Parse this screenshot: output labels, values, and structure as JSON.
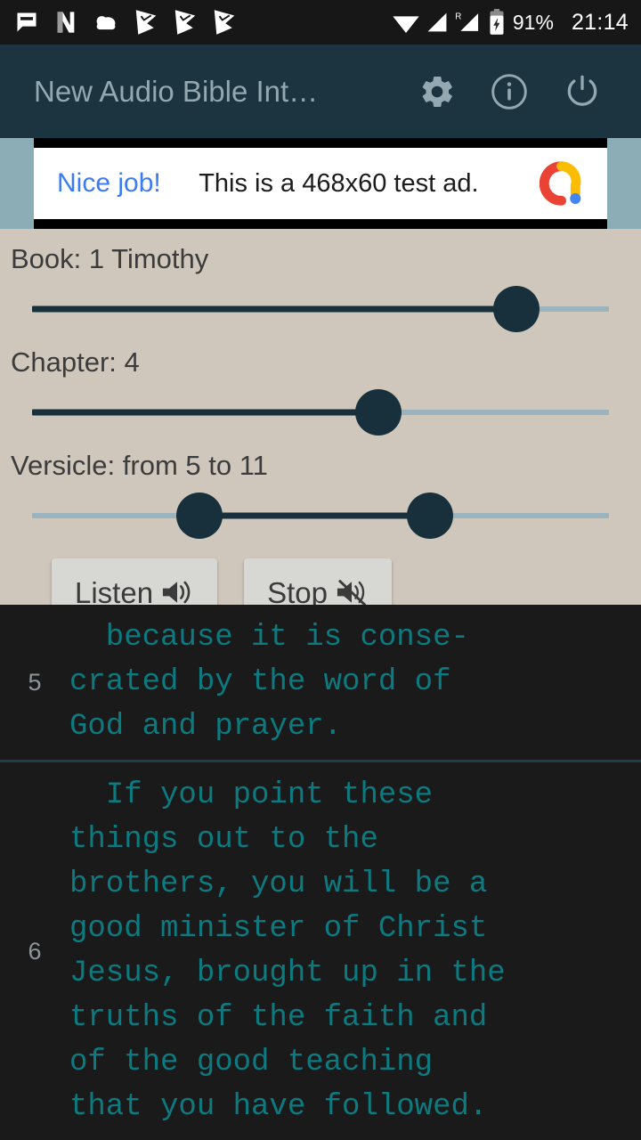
{
  "status_bar": {
    "icons_left": [
      "message-icon",
      "netflix-n-icon",
      "cloud-icon",
      "check-flag-icon",
      "check-flag-icon",
      "check-flag-icon"
    ],
    "icons_right": [
      "wifi-icon",
      "signal-icon",
      "signal-roaming-icon",
      "battery-charging-icon"
    ],
    "roaming_label": "R",
    "battery_percent": "91%",
    "clock": "21:14",
    "background": "#171717",
    "foreground": "#ffffff"
  },
  "app_bar": {
    "title": "New Audio Bible Int…",
    "background": "#1b3440",
    "icon_color": "#93a8b0",
    "actions": [
      {
        "name": "settings-button",
        "icon": "gear-icon"
      },
      {
        "name": "info-button",
        "icon": "info-circle-icon"
      },
      {
        "name": "power-button",
        "icon": "power-icon"
      }
    ]
  },
  "ad": {
    "cta": "Nice job!",
    "text": "This is a 468x60 test ad.",
    "cta_color": "#3d7bf2",
    "logo": "admob-logo-icon",
    "surround_color": "#8cacb6"
  },
  "controls": {
    "background": "#cfc7bc",
    "accent": "#17303c",
    "track_color": "#9bb3bc",
    "book": {
      "label": "Book: 1 Timothy",
      "value": "1 Timothy",
      "thumb_percent": 84
    },
    "chapter": {
      "label": "Chapter: 4",
      "value": "4",
      "thumb_percent": 60
    },
    "versicle": {
      "label": "Versicle: from 5 to 11",
      "from": "5",
      "to": "11",
      "thumb_low_percent": 29,
      "thumb_high_percent": 69
    },
    "listen_button": "Listen",
    "listen_icon": "speaker-on-icon",
    "stop_button": "Stop",
    "stop_icon": "speaker-muted-icon"
  },
  "verses": {
    "text_color": "#0d7a80",
    "number_color": "#8b969b",
    "background": "#1a1a1a",
    "items": [
      {
        "number": "5",
        "lines": "  because it is conse-\ncrated by the word of\nGod and prayer."
      },
      {
        "number": "6",
        "lines": "  If you point these\nthings out to the\nbrothers, you will be a\ngood minister of Christ\nJesus, brought up in the\ntruths of the faith and\nof the good teaching\nthat you have followed."
      }
    ]
  }
}
